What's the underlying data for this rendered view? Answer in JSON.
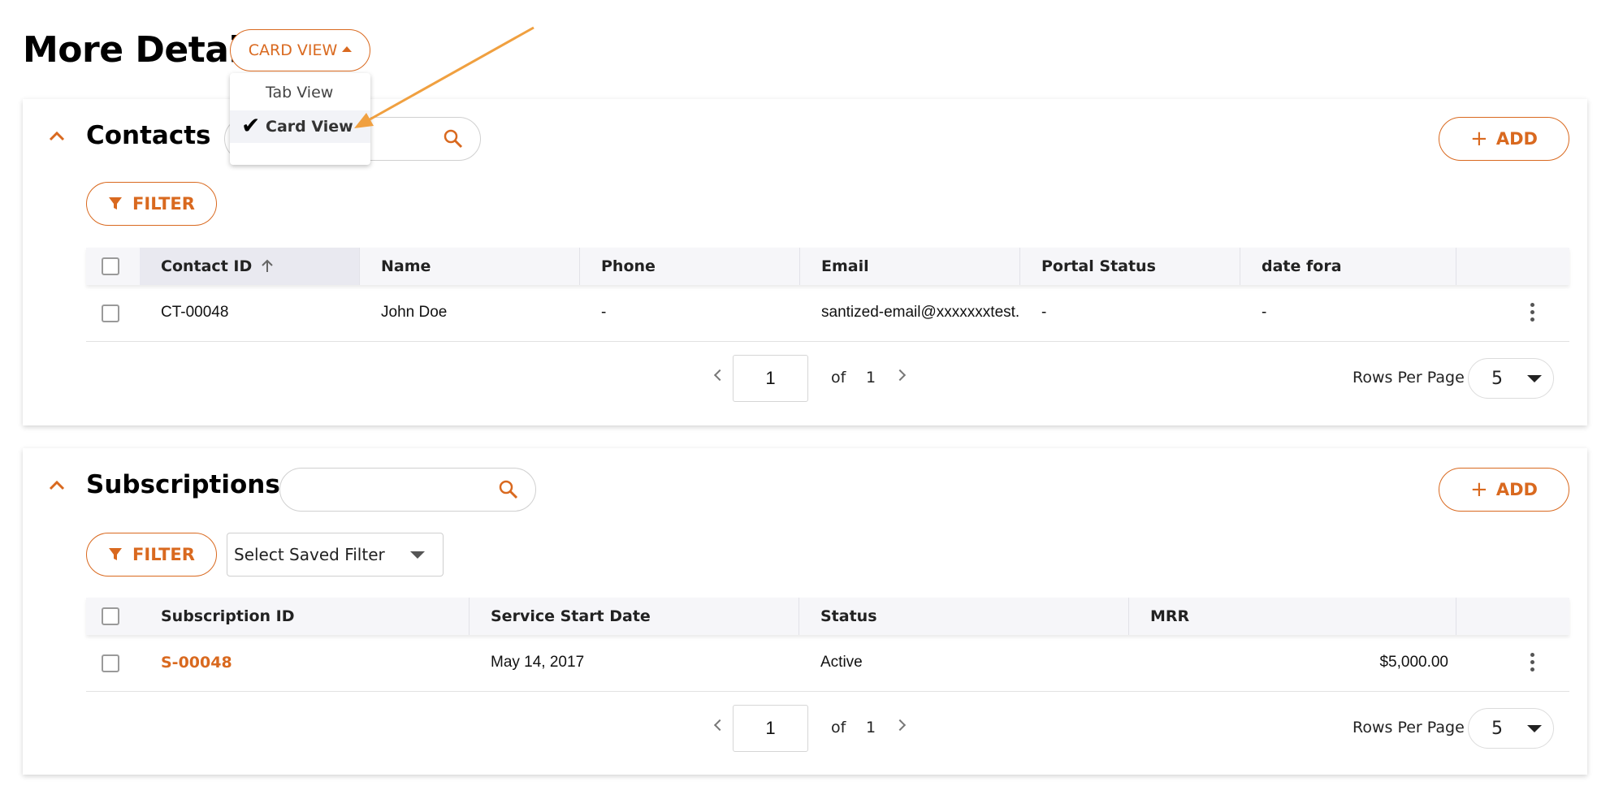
{
  "page": {
    "title": "More Details"
  },
  "view_toggle": {
    "label": "CARD VIEW",
    "options": [
      {
        "label": "Tab View",
        "selected": false
      },
      {
        "label": "Card View",
        "selected": true
      }
    ]
  },
  "contacts": {
    "title": "Contacts",
    "search": {
      "placeholder": ""
    },
    "add_label": "ADD",
    "filter_label": "FILTER",
    "columns": [
      "Contact ID",
      "Name",
      "Phone",
      "Email",
      "Portal Status",
      "date fora"
    ],
    "rows": [
      [
        "CT-00048",
        "John Doe",
        "-",
        "santized-email@xxxxxxxtest.com",
        "-",
        "-"
      ]
    ],
    "pagination": {
      "page": "1",
      "of_label": "of",
      "total": "1",
      "rows_label": "Rows Per Page",
      "rows_value": "5"
    }
  },
  "subscriptions": {
    "title": "Subscriptions",
    "search": {
      "placeholder": ""
    },
    "add_label": "ADD",
    "filter_label": "FILTER",
    "saved_filter": "Select Saved Filter",
    "columns": [
      "Subscription ID",
      "Service Start Date",
      "Status",
      "MRR"
    ],
    "rows": [
      [
        "S-00048",
        "May 14, 2017",
        "Active",
        "$5,000.00"
      ]
    ],
    "pagination": {
      "page": "1",
      "of_label": "of",
      "total": "1",
      "rows_label": "Rows Per Page",
      "rows_value": "5"
    }
  },
  "colors": {
    "accent": "#d9691f",
    "annotation_arrow": "#f0a040"
  }
}
